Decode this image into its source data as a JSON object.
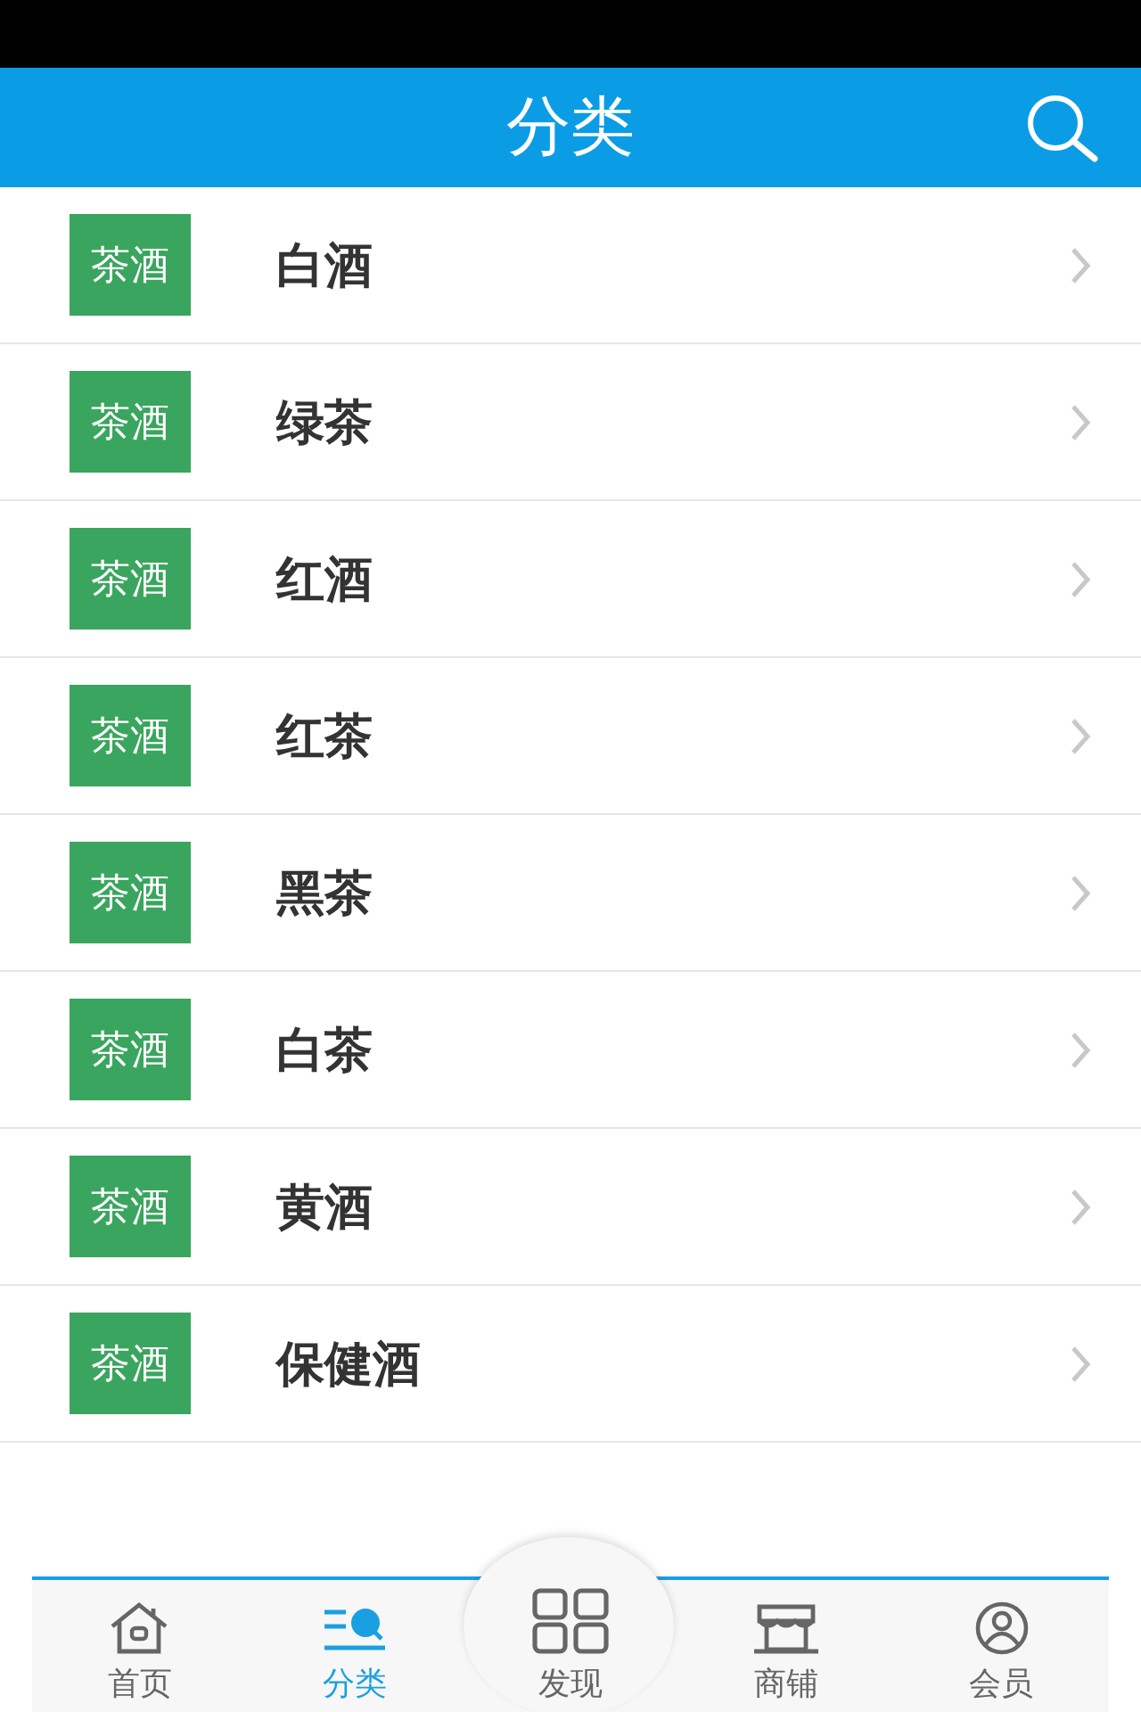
{
  "header": {
    "title": "分类"
  },
  "categories": [
    {
      "thumb": "茶酒",
      "name": "白酒"
    },
    {
      "thumb": "茶酒",
      "name": "绿茶"
    },
    {
      "thumb": "茶酒",
      "name": "红酒"
    },
    {
      "thumb": "茶酒",
      "name": "红茶"
    },
    {
      "thumb": "茶酒",
      "name": "黑茶"
    },
    {
      "thumb": "茶酒",
      "name": "白茶"
    },
    {
      "thumb": "茶酒",
      "name": "黄酒"
    },
    {
      "thumb": "茶酒",
      "name": "保健酒"
    }
  ],
  "tab_bar": [
    {
      "label": "首页",
      "selected": false
    },
    {
      "label": "分类",
      "selected": true
    },
    {
      "label": "发现",
      "selected": false
    },
    {
      "label": "商铺",
      "selected": false
    },
    {
      "label": "会员",
      "selected": false
    }
  ]
}
